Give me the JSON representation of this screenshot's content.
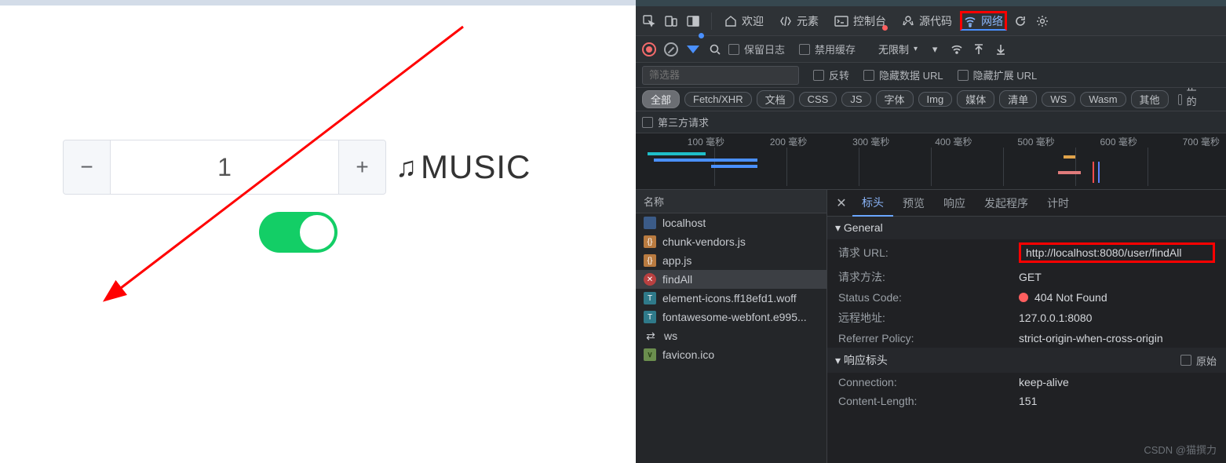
{
  "left": {
    "counter_value": "1",
    "music_label": "MUSIC"
  },
  "toolbar": {
    "welcome": "欢迎",
    "elements": "元素",
    "console": "控制台",
    "sources": "源代码",
    "network": "网络"
  },
  "subbar": {
    "preserve_log": "保留日志",
    "disable_cache": "禁用缓存",
    "throttle": "无限制"
  },
  "filter": {
    "placeholder": "筛选器",
    "invert": "反转",
    "hide_data_urls": "隐藏数据 URL",
    "hide_ext_urls": "隐藏扩展 URL"
  },
  "types": [
    "全部",
    "Fetch/XHR",
    "文档",
    "CSS",
    "JS",
    "字体",
    "Img",
    "媒体",
    "清单",
    "WS",
    "Wasm",
    "其他"
  ],
  "types_tail": "已阻止的响应 Co",
  "thirdparty": "第三方请求",
  "timeline_ticks": [
    "100 毫秒",
    "200 毫秒",
    "300 毫秒",
    "400 毫秒",
    "500 毫秒",
    "600 毫秒",
    "700 毫秒"
  ],
  "reqlist": {
    "header": "名称",
    "items": [
      {
        "label": "localhost",
        "badge": "b-html",
        "glyph": ""
      },
      {
        "label": "chunk-vendors.js",
        "badge": "b-js",
        "glyph": "{}"
      },
      {
        "label": "app.js",
        "badge": "b-js",
        "glyph": "{}"
      },
      {
        "label": "findAll",
        "badge": "b-err",
        "glyph": "✕"
      },
      {
        "label": "element-icons.ff18efd1.woff",
        "badge": "b-font",
        "glyph": "T"
      },
      {
        "label": "fontawesome-webfont.e995...",
        "badge": "b-font",
        "glyph": "T"
      },
      {
        "label": "ws",
        "badge": "b-ws",
        "glyph": "⇄"
      },
      {
        "label": "favicon.ico",
        "badge": "b-ico",
        "glyph": "∨"
      }
    ]
  },
  "detail": {
    "close": "✕",
    "tabs": [
      "标头",
      "预览",
      "响应",
      "发起程序",
      "计时"
    ],
    "general_hdr": "▾ General",
    "resp_hdr_label": "▾ 响应标头",
    "raw_label": "原始",
    "general": [
      {
        "k": "请求 URL:",
        "v": "http://localhost:8080/user/findAll",
        "box": true
      },
      {
        "k": "请求方法:",
        "v": "GET"
      },
      {
        "k": "Status Code:",
        "v": "404 Not Found",
        "dot": true
      },
      {
        "k": "远程地址:",
        "v": "127.0.0.1:8080"
      },
      {
        "k": "Referrer Policy:",
        "v": "strict-origin-when-cross-origin"
      }
    ],
    "resp_headers": [
      {
        "k": "Connection:",
        "v": "keep-alive"
      },
      {
        "k": "Content-Length:",
        "v": "151"
      }
    ]
  },
  "watermark": "CSDN @猫撰力"
}
